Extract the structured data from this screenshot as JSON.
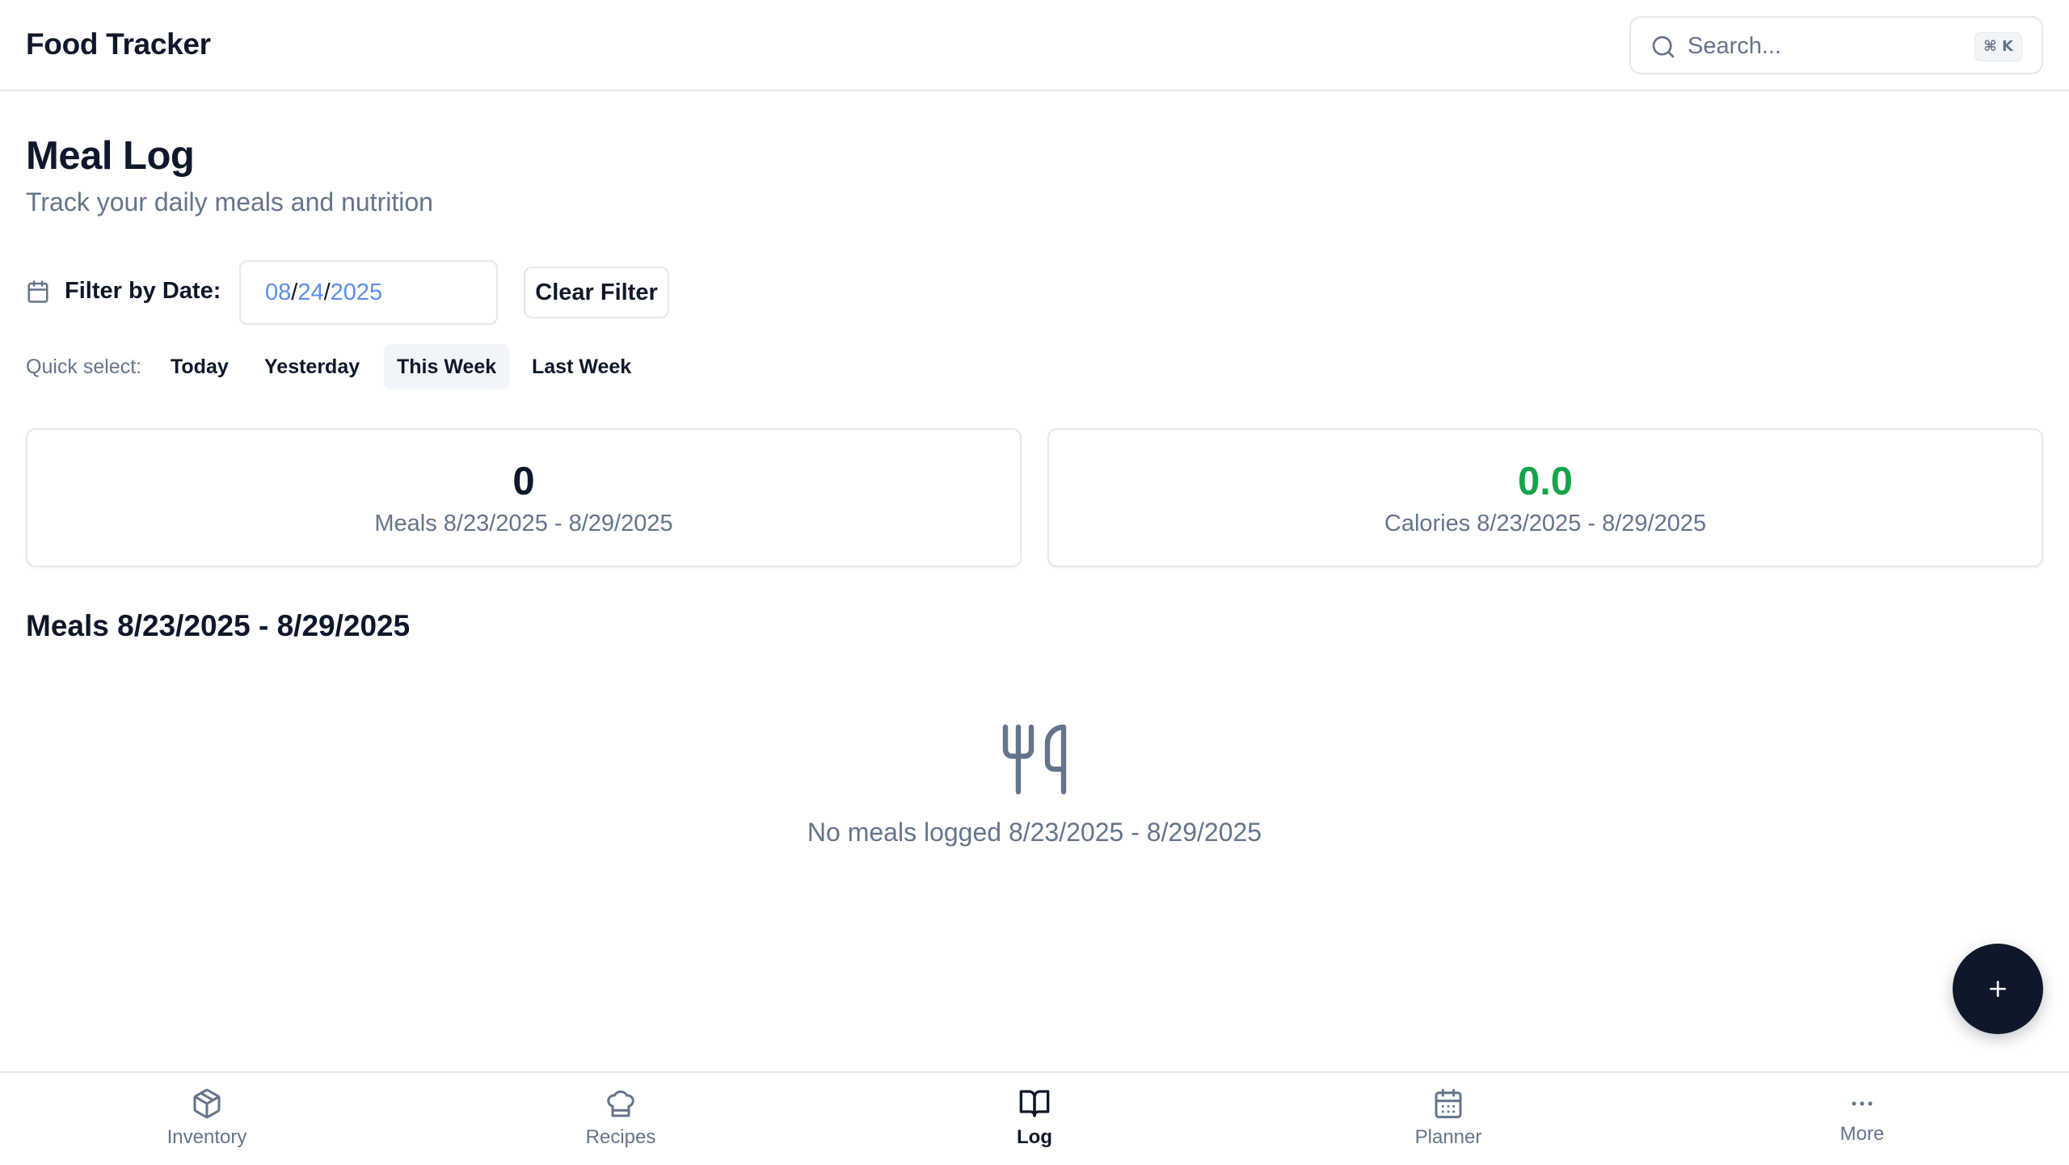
{
  "header": {
    "app_title": "Food Tracker",
    "search": {
      "placeholder": "Search...",
      "shortcut": "⌘ K"
    }
  },
  "page": {
    "title": "Meal Log",
    "subtitle": "Track your daily meals and nutrition"
  },
  "filter": {
    "label": "Filter by Date:",
    "date": {
      "month": "08",
      "day": "24",
      "year": "2025"
    },
    "clear_label": "Clear Filter"
  },
  "quick_select": {
    "label": "Quick select:",
    "options": [
      "Today",
      "Yesterday",
      "This Week",
      "Last Week"
    ],
    "selected": "This Week"
  },
  "stats": {
    "meals": {
      "value": "0",
      "label": "Meals 8/23/2025 - 8/29/2025"
    },
    "calories": {
      "value": "0.0",
      "label": "Calories 8/23/2025 - 8/29/2025",
      "color": "#16a34a"
    }
  },
  "meals_section": {
    "title": "Meals 8/23/2025 - 8/29/2025",
    "empty_icon": "utensils-icon",
    "empty_text": "No meals logged 8/23/2025 - 8/29/2025"
  },
  "fab": {
    "icon": "plus-icon"
  },
  "bottom_nav": {
    "items": [
      {
        "label": "Inventory",
        "icon": "package-icon"
      },
      {
        "label": "Recipes",
        "icon": "chef-hat-icon"
      },
      {
        "label": "Log",
        "icon": "book-open-icon"
      },
      {
        "label": "Planner",
        "icon": "calendar-icon"
      },
      {
        "label": "More",
        "icon": "more-horizontal-icon"
      }
    ],
    "active": "Log"
  },
  "colors": {
    "primary": "#0f172a",
    "muted_text": "#64748b",
    "border": "#e5e7eb",
    "success": "#16a34a",
    "date_value": "#5b8def"
  }
}
